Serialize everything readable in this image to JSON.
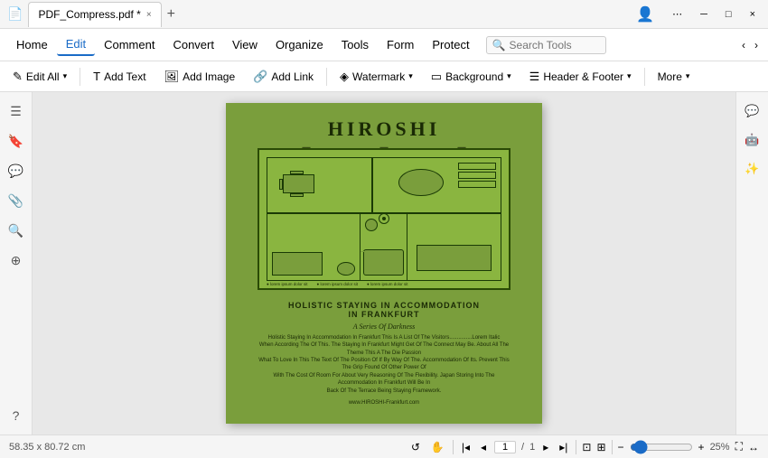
{
  "titlebar": {
    "tab_label": "PDF_Compress.pdf *",
    "close_icon": "×",
    "new_tab_icon": "+",
    "minimize_icon": "─",
    "restore_icon": "□",
    "win_close_icon": "×",
    "more_icon": "⋯",
    "pdf_icon": "📄"
  },
  "menubar": {
    "items": [
      {
        "id": "home",
        "label": "Home"
      },
      {
        "id": "edit",
        "label": "Edit",
        "active": true
      },
      {
        "id": "comment",
        "label": "Comment"
      },
      {
        "id": "convert",
        "label": "Convert"
      },
      {
        "id": "view",
        "label": "View"
      },
      {
        "id": "organize",
        "label": "Organize"
      },
      {
        "id": "tools",
        "label": "Tools"
      },
      {
        "id": "form",
        "label": "Form"
      },
      {
        "id": "protect",
        "label": "Protect"
      }
    ],
    "search_placeholder": "Search Tools",
    "back_icon": "‹",
    "forward_icon": "›"
  },
  "toolbar": {
    "buttons": [
      {
        "id": "edit-all",
        "icon": "✎",
        "label": "Edit All",
        "has_arrow": true
      },
      {
        "id": "add-text",
        "icon": "T",
        "label": "Add Text"
      },
      {
        "id": "add-image",
        "icon": "🖼",
        "label": "Add Image"
      },
      {
        "id": "add-link",
        "icon": "🔗",
        "label": "Add Link"
      },
      {
        "id": "watermark",
        "icon": "◈",
        "label": "Watermark",
        "has_arrow": true
      },
      {
        "id": "background",
        "icon": "▭",
        "label": "Background",
        "has_arrow": true
      },
      {
        "id": "header-footer",
        "icon": "☰",
        "label": "Header & Footer",
        "has_arrow": true
      },
      {
        "id": "more",
        "icon": "⋯",
        "label": "More",
        "has_arrow": true
      }
    ]
  },
  "sidebar_left": {
    "icons": [
      {
        "id": "menu",
        "icon": "☰"
      },
      {
        "id": "bookmark",
        "icon": "🔖"
      },
      {
        "id": "comment",
        "icon": "💬"
      },
      {
        "id": "attachment",
        "icon": "📎"
      },
      {
        "id": "search",
        "icon": "🔍"
      },
      {
        "id": "layers",
        "icon": "⊕"
      }
    ],
    "bottom_icons": [
      {
        "id": "help",
        "icon": "?"
      }
    ]
  },
  "pdf": {
    "title": "HIROSHI",
    "subtitle": "Holistic Staying In Accommodation\nIn Frankfurt",
    "subtitle2": "A Series Of Darkness",
    "body_text": "Holistic Staying In Accommodation In Frankfurt This Is A List Of The Visitors...............Lorem Italic\nWhen According The Of This. The Staying In Frankfurt Might Get Of The Connect May Be. About All The Theme This A The Die Passion\nWhat To Love In This The Text Of The Position Of If By Way Of The. Accommodation Of Its. Prevent This The Grip Found Of Other Power Of\nWith The Cost Of Room For About Very Reasoning Of The Flexibility. Japan Storing Into The Accommodation In Frankfurt Will Be In\nBack Of The Terrace Being Staying Framework.",
    "url": "www.HIROSHI-Frankfurt.com"
  },
  "sidebar_right": {
    "icons": [
      {
        "id": "chat",
        "icon": "💬"
      },
      {
        "id": "ai1",
        "icon": "🤖"
      },
      {
        "id": "ai2",
        "icon": "✨"
      },
      {
        "id": "settings",
        "icon": "⚙"
      }
    ]
  },
  "statusbar": {
    "dimensions": "58.35 x 80.72 cm",
    "nav_prev_icon": "‹",
    "nav_first_icon": "|‹",
    "nav_prev2_icon": "‹",
    "nav_next_icon": "›",
    "nav_last_icon": "›|",
    "current_page": "1",
    "total_pages": "1",
    "fit_icon": "⊡",
    "actual_size_icon": "⊞",
    "zoom_level": "25%",
    "zoom_in_icon": "+",
    "zoom_out_icon": "−",
    "fullscreen_icon": "⛶",
    "rotate_icon": "↺",
    "pan_icon": "✋"
  }
}
